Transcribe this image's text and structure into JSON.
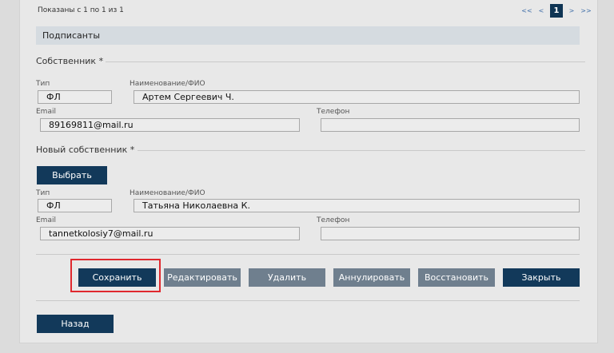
{
  "pagination": {
    "summary": "Показаны с 1 по 1 из 1",
    "first": "<<",
    "prev": "<",
    "current": "1",
    "next": ">",
    "last": ">>"
  },
  "section_title": "Подписанты",
  "owner": {
    "legend": "Собственник *",
    "type_label": "Тип",
    "type_value": "ФЛ",
    "name_label": "Наименование/ФИО",
    "name_value": "Артем Сергеевич Ч.",
    "email_label": "Email",
    "email_value": "89169811@mail.ru",
    "phone_label": "Телефон",
    "phone_value": ""
  },
  "new_owner": {
    "legend": "Новый собственник *",
    "select_button": "Выбрать",
    "type_label": "Тип",
    "type_value": "ФЛ",
    "name_label": "Наименование/ФИО",
    "name_value": "Татьяна Николаевна К.",
    "email_label": "Email",
    "email_value": "tannetkolosiy7@mail.ru",
    "phone_label": "Телефон",
    "phone_value": ""
  },
  "actions": {
    "save": "Сохранить",
    "edit": "Редактировать",
    "delete": "Удалить",
    "annul": "Аннулировать",
    "restore": "Восстановить",
    "close": "Закрыть"
  },
  "back_button": "Назад",
  "colors": {
    "primary": "#12395a",
    "disabled": "#6f7f8e",
    "highlight": "#e0282e"
  }
}
